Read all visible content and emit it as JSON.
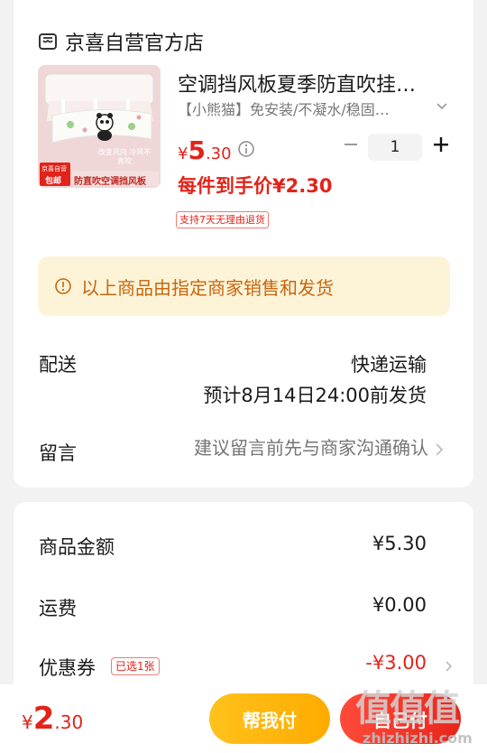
{
  "store": {
    "name": "京喜自营官方店",
    "icon": "store-icon"
  },
  "product": {
    "title": "空调挡风板夏季防直吹挂…",
    "spec": "【小熊猫】免安装/不凝水/稳固…",
    "price_symbol": "¥",
    "price_int": "5",
    "price_dec": ".30",
    "quantity": "1",
    "promo_price": "每件到手价¥2.30",
    "return_policy": "支持7天无理由退货",
    "image": {
      "badge_top": "京喜自营",
      "badge_bottom": "包邮",
      "caption": "防直吹空调挡风板",
      "overlay": "改变风向 冷风不直吹"
    }
  },
  "notice": {
    "text": "以上商品由指定商家销售和发货"
  },
  "shipping": {
    "label": "配送",
    "method": "快递运输",
    "eta": "预计8月14日24:00前发货"
  },
  "message": {
    "label": "留言",
    "placeholder": "建议留言前先与商家沟通确认"
  },
  "summary": {
    "goods_label": "商品金额",
    "goods_value": "¥5.30",
    "freight_label": "运费",
    "freight_value": "¥0.00",
    "coupon_label": "优惠券",
    "coupon_badge": "已选1张",
    "coupon_value": "-¥3.00"
  },
  "bottom": {
    "total_symbol": "¥",
    "total_int": "2",
    "total_dec": ".30",
    "help_pay": "帮我付",
    "self_pay": "自己付"
  },
  "watermark": {
    "logo": "值值值",
    "url": "zhizhizhi.com"
  },
  "colors": {
    "accent_red": "#e2231a",
    "notice_bg": "#fdf4d8",
    "notice_text": "#c8660f",
    "help_pay_yellow": "#ffb300"
  }
}
